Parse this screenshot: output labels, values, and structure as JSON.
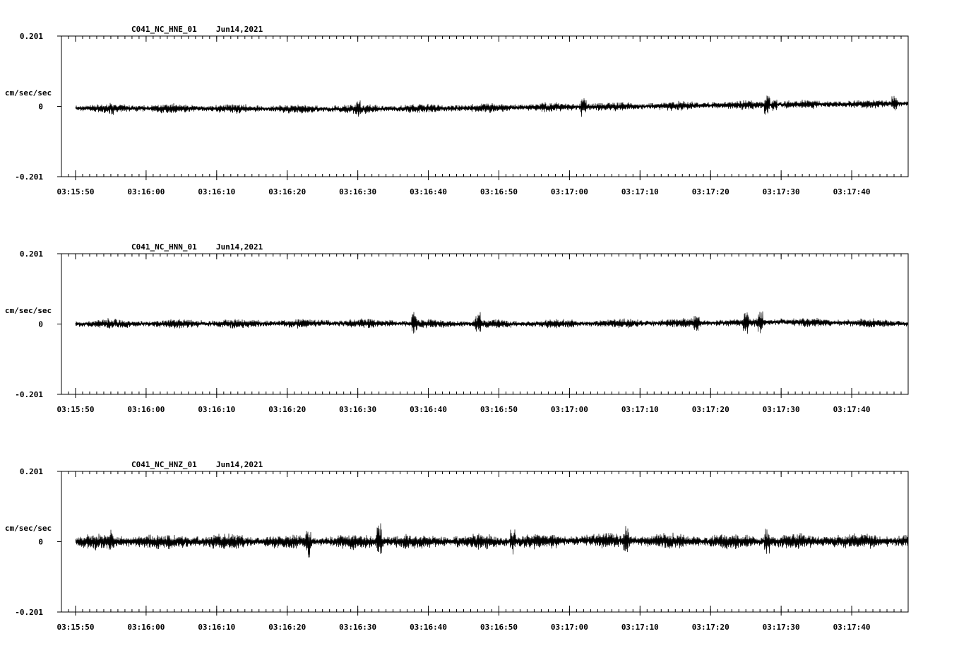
{
  "chart_data": [
    {
      "type": "line",
      "title": "C041_NC_HNE_01",
      "date": "Jun14,2021",
      "ylabel": "cm/sec/sec",
      "ylim": [
        -0.201,
        0.201
      ],
      "ytick_labels": [
        "0.201",
        "0",
        "-0.201"
      ],
      "x_start": "03:15:48",
      "x_end": "03:17:48",
      "data_start": "03:15:50",
      "xtick_labels": [
        "03:15:50",
        "03:16:00",
        "03:16:10",
        "03:16:20",
        "03:16:30",
        "03:16:40",
        "03:16:50",
        "03:17:00",
        "03:17:10",
        "03:17:20",
        "03:17:30",
        "03:17:40"
      ],
      "grid": false,
      "series": [
        {
          "noise_amplitude": 0.012,
          "trend": [
            [
              0,
              -0.005
            ],
            [
              40,
              -0.008
            ],
            [
              60,
              -0.004
            ],
            [
              80,
              0.0
            ],
            [
              100,
              0.005
            ],
            [
              118,
              0.008
            ]
          ],
          "spikes": [
            [
              5,
              0.02
            ],
            [
              40,
              -0.03
            ],
            [
              72,
              0.03
            ],
            [
              98,
              0.036
            ],
            [
              99,
              -0.02
            ],
            [
              116,
              0.025
            ]
          ],
          "seed": 11
        }
      ]
    },
    {
      "type": "line",
      "title": "C041_NC_HNN_01",
      "date": "Jun14,2021",
      "ylabel": "cm/sec/sec",
      "ylim": [
        -0.201,
        0.201
      ],
      "ytick_labels": [
        "0.201",
        "0",
        "-0.201"
      ],
      "x_start": "03:15:48",
      "x_end": "03:17:48",
      "data_start": "03:15:50",
      "xtick_labels": [
        "03:15:50",
        "03:16:00",
        "03:16:10",
        "03:16:20",
        "03:16:30",
        "03:16:40",
        "03:16:50",
        "03:17:00",
        "03:17:10",
        "03:17:20",
        "03:17:30",
        "03:17:40"
      ],
      "grid": false,
      "series": [
        {
          "noise_amplitude": 0.012,
          "trend": [
            [
              0,
              0.0
            ],
            [
              40,
              0.002
            ],
            [
              60,
              0.0
            ],
            [
              90,
              0.003
            ],
            [
              100,
              0.006
            ],
            [
              118,
              0.001
            ]
          ],
          "spikes": [
            [
              5,
              0.02
            ],
            [
              48,
              -0.035
            ],
            [
              57,
              0.035
            ],
            [
              88,
              0.03
            ],
            [
              95,
              0.04
            ],
            [
              97,
              -0.04
            ]
          ],
          "seed": 23
        }
      ]
    },
    {
      "type": "line",
      "title": "C041_NC_HNZ_01",
      "date": "Jun14,2021",
      "ylabel": "cm/sec/sec",
      "ylim": [
        -0.201,
        0.201
      ],
      "ytick_labels": [
        "0.201",
        "0",
        "-0.201"
      ],
      "x_start": "03:15:48",
      "x_end": "03:17:48",
      "data_start": "03:15:50",
      "xtick_labels": [
        "03:15:50",
        "03:16:00",
        "03:16:10",
        "03:16:20",
        "03:16:30",
        "03:16:40",
        "03:16:50",
        "03:17:00",
        "03:17:10",
        "03:17:20",
        "03:17:30",
        "03:17:40"
      ],
      "grid": false,
      "series": [
        {
          "noise_amplitude": 0.02,
          "trend": [
            [
              0,
              0.0
            ],
            [
              60,
              0.0
            ],
            [
              75,
              0.004
            ],
            [
              90,
              0.0
            ],
            [
              118,
              0.002
            ]
          ],
          "spikes": [
            [
              5,
              0.035
            ],
            [
              33,
              0.05
            ],
            [
              43,
              -0.06
            ],
            [
              62,
              0.04
            ],
            [
              78,
              0.05
            ],
            [
              98,
              -0.045
            ]
          ],
          "seed": 37
        }
      ]
    }
  ]
}
